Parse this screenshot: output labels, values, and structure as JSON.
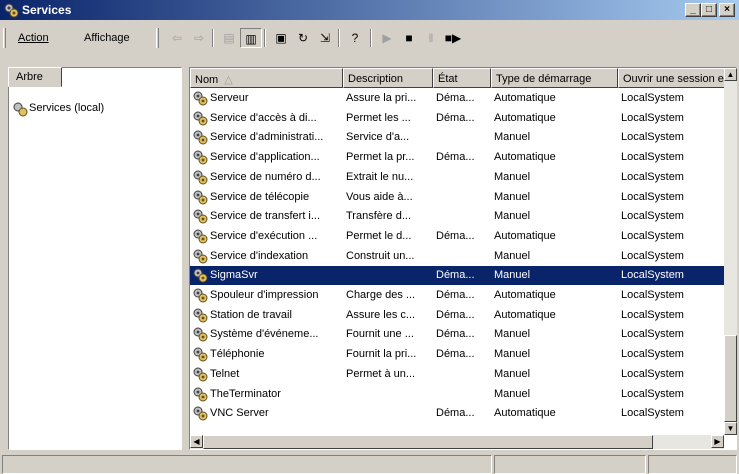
{
  "window": {
    "title": "Services"
  },
  "menu": {
    "action_label": "Action",
    "view_label": "Affichage"
  },
  "left": {
    "tab_label": "Arbre",
    "tree_root": "Services (local)"
  },
  "columns": [
    "Nom",
    "Description",
    "État",
    "Type de démarrage",
    "Ouvrir une session en tant que"
  ],
  "rows": [
    {
      "name": "Serveur",
      "desc": "Assure la pri...",
      "state": "Déma...",
      "startup": "Automatique",
      "logon": "LocalSystem"
    },
    {
      "name": "Service d'accès à di...",
      "desc": "Permet les ...",
      "state": "Déma...",
      "startup": "Automatique",
      "logon": "LocalSystem"
    },
    {
      "name": "Service d'administrati...",
      "desc": "Service d'a...",
      "state": "",
      "startup": "Manuel",
      "logon": "LocalSystem"
    },
    {
      "name": "Service d'application...",
      "desc": "Permet la pr...",
      "state": "Déma...",
      "startup": "Automatique",
      "logon": "LocalSystem"
    },
    {
      "name": "Service de numéro d...",
      "desc": "Extrait le nu...",
      "state": "",
      "startup": "Manuel",
      "logon": "LocalSystem"
    },
    {
      "name": "Service de télécopie",
      "desc": "Vous aide à...",
      "state": "",
      "startup": "Manuel",
      "logon": "LocalSystem"
    },
    {
      "name": "Service de transfert i...",
      "desc": "Transfère d...",
      "state": "",
      "startup": "Manuel",
      "logon": "LocalSystem"
    },
    {
      "name": "Service d'exécution ...",
      "desc": "Permet le d...",
      "state": "Déma...",
      "startup": "Automatique",
      "logon": "LocalSystem"
    },
    {
      "name": "Service d'indexation",
      "desc": "Construit un...",
      "state": "",
      "startup": "Manuel",
      "logon": "LocalSystem"
    },
    {
      "name": "SigmaSvr",
      "desc": "",
      "state": "Déma...",
      "startup": "Manuel",
      "logon": "LocalSystem",
      "selected": true
    },
    {
      "name": "Spouleur d'impression",
      "desc": "Charge des ...",
      "state": "Déma...",
      "startup": "Automatique",
      "logon": "LocalSystem"
    },
    {
      "name": "Station de travail",
      "desc": "Assure les c...",
      "state": "Déma...",
      "startup": "Automatique",
      "logon": "LocalSystem"
    },
    {
      "name": "Système d'événeme...",
      "desc": "Fournit une ...",
      "state": "Déma...",
      "startup": "Manuel",
      "logon": "LocalSystem"
    },
    {
      "name": "Téléphonie",
      "desc": "Fournit la pri...",
      "state": "Déma...",
      "startup": "Manuel",
      "logon": "LocalSystem"
    },
    {
      "name": "Telnet",
      "desc": "Permet à un...",
      "state": "",
      "startup": "Manuel",
      "logon": "LocalSystem"
    },
    {
      "name": "TheTerminator",
      "desc": "",
      "state": "",
      "startup": "Manuel",
      "logon": "LocalSystem"
    },
    {
      "name": "VNC Server",
      "desc": "",
      "state": "Déma...",
      "startup": "Automatique",
      "logon": "LocalSystem"
    }
  ],
  "colors": {
    "selection": "#0a246a",
    "titlebar": "#0a246a",
    "face": "#d4d0c8"
  },
  "icons": [
    "gear-icon",
    "back-icon",
    "forward-icon",
    "up-icon",
    "show-tree-icon",
    "properties-icon",
    "refresh-icon",
    "export-icon",
    "help-icon",
    "play-icon",
    "stop-icon",
    "pause-icon",
    "restart-icon"
  ]
}
